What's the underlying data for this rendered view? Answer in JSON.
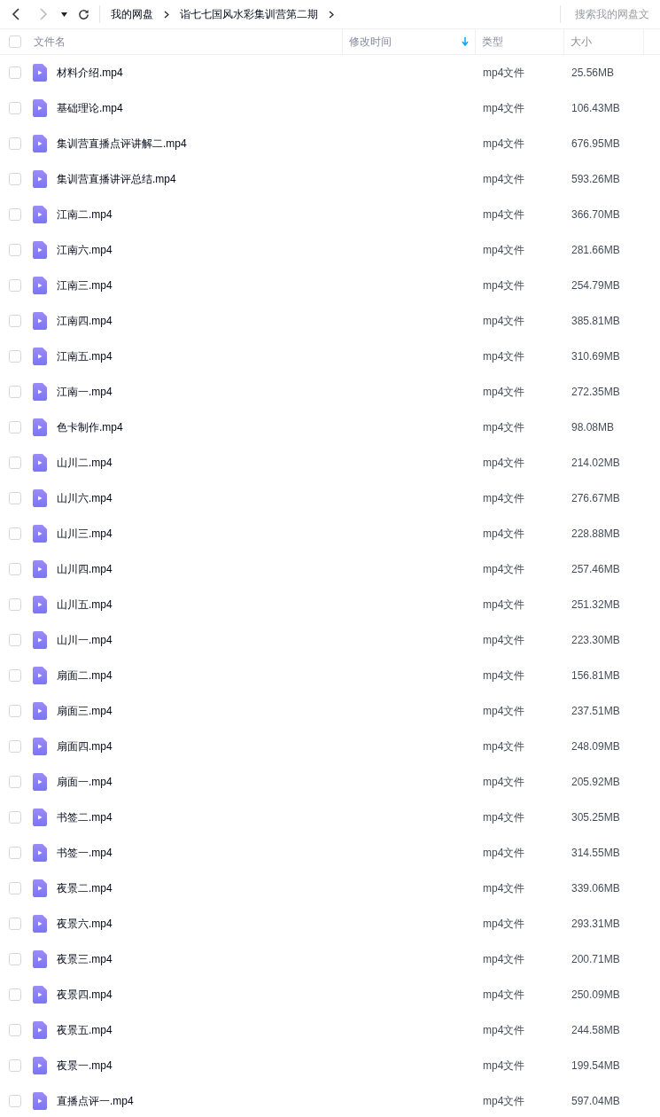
{
  "toolbar": {
    "breadcrumb": [
      {
        "label": "我的网盘"
      },
      {
        "label": "诣七七国风水彩集训营第二期"
      }
    ],
    "search": {
      "placeholder": "搜索我的网盘文"
    }
  },
  "table": {
    "select_all": {
      "checked": false
    },
    "columns": [
      {
        "label": "文件名",
        "sorted": false
      },
      {
        "label": "修改时间",
        "sorted": true
      },
      {
        "label": "类型",
        "sorted": false
      },
      {
        "label": "大小",
        "sorted": false
      }
    ],
    "rows": [
      {
        "name": "材料介绍.mp4",
        "type": "mp4文件",
        "size": "25.56MB",
        "checked": false
      },
      {
        "name": "基础理论.mp4",
        "type": "mp4文件",
        "size": "106.43MB",
        "checked": false
      },
      {
        "name": "集训营直播点评讲解二.mp4",
        "type": "mp4文件",
        "size": "676.95MB",
        "checked": false
      },
      {
        "name": "集训营直播讲评总结.mp4",
        "type": "mp4文件",
        "size": "593.26MB",
        "checked": false
      },
      {
        "name": "江南二.mp4",
        "type": "mp4文件",
        "size": "366.70MB",
        "checked": false
      },
      {
        "name": "江南六.mp4",
        "type": "mp4文件",
        "size": "281.66MB",
        "checked": false
      },
      {
        "name": "江南三.mp4",
        "type": "mp4文件",
        "size": "254.79MB",
        "checked": false
      },
      {
        "name": "江南四.mp4",
        "type": "mp4文件",
        "size": "385.81MB",
        "checked": false
      },
      {
        "name": "江南五.mp4",
        "type": "mp4文件",
        "size": "310.69MB",
        "checked": false
      },
      {
        "name": "江南一.mp4",
        "type": "mp4文件",
        "size": "272.35MB",
        "checked": false
      },
      {
        "name": "色卡制作.mp4",
        "type": "mp4文件",
        "size": "98.08MB",
        "checked": false
      },
      {
        "name": "山川二.mp4",
        "type": "mp4文件",
        "size": "214.02MB",
        "checked": false
      },
      {
        "name": "山川六.mp4",
        "type": "mp4文件",
        "size": "276.67MB",
        "checked": false
      },
      {
        "name": "山川三.mp4",
        "type": "mp4文件",
        "size": "228.88MB",
        "checked": false
      },
      {
        "name": "山川四.mp4",
        "type": "mp4文件",
        "size": "257.46MB",
        "checked": false
      },
      {
        "name": "山川五.mp4",
        "type": "mp4文件",
        "size": "251.32MB",
        "checked": false
      },
      {
        "name": "山川一.mp4",
        "type": "mp4文件",
        "size": "223.30MB",
        "checked": false
      },
      {
        "name": "扇面二.mp4",
        "type": "mp4文件",
        "size": "156.81MB",
        "checked": false
      },
      {
        "name": "扇面三.mp4",
        "type": "mp4文件",
        "size": "237.51MB",
        "checked": false
      },
      {
        "name": "扇面四.mp4",
        "type": "mp4文件",
        "size": "248.09MB",
        "checked": false
      },
      {
        "name": "扇面一.mp4",
        "type": "mp4文件",
        "size": "205.92MB",
        "checked": false
      },
      {
        "name": "书签二.mp4",
        "type": "mp4文件",
        "size": "305.25MB",
        "checked": false
      },
      {
        "name": "书签一.mp4",
        "type": "mp4文件",
        "size": "314.55MB",
        "checked": false
      },
      {
        "name": "夜景二.mp4",
        "type": "mp4文件",
        "size": "339.06MB",
        "checked": false
      },
      {
        "name": "夜景六.mp4",
        "type": "mp4文件",
        "size": "293.31MB",
        "checked": false
      },
      {
        "name": "夜景三.mp4",
        "type": "mp4文件",
        "size": "200.71MB",
        "checked": false
      },
      {
        "name": "夜景四.mp4",
        "type": "mp4文件",
        "size": "250.09MB",
        "checked": false
      },
      {
        "name": "夜景五.mp4",
        "type": "mp4文件",
        "size": "244.58MB",
        "checked": false
      },
      {
        "name": "夜景一.mp4",
        "type": "mp4文件",
        "size": "199.54MB",
        "checked": false
      },
      {
        "name": "直播点评一.mp4",
        "type": "mp4文件",
        "size": "597.04MB",
        "checked": false
      }
    ]
  }
}
